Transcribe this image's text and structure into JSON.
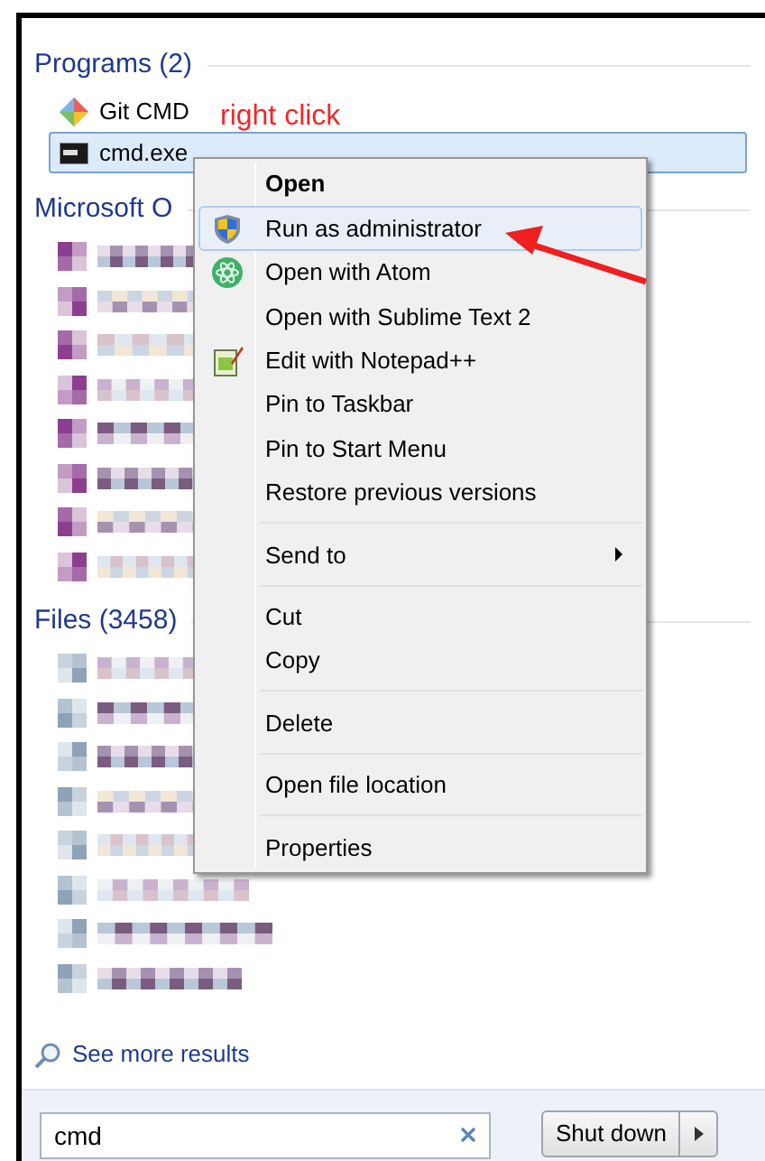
{
  "programs": {
    "header": "Programs (2)",
    "items": [
      {
        "kind": "git",
        "label": "Git CMD",
        "selected": false
      },
      {
        "kind": "console",
        "label": "cmd.exe",
        "selected": true
      }
    ]
  },
  "annotation": {
    "label": "right click"
  },
  "office": {
    "header": "Microsoft O",
    "items": [
      {
        "kind": "office"
      },
      {
        "kind": "office"
      },
      {
        "kind": "office"
      },
      {
        "kind": "office"
      },
      {
        "kind": "office"
      },
      {
        "kind": "office"
      },
      {
        "kind": "office"
      },
      {
        "kind": "office"
      }
    ]
  },
  "files": {
    "header": "Files (3458)",
    "items": [
      {
        "kind": "file"
      },
      {
        "kind": "file"
      },
      {
        "kind": "file"
      },
      {
        "kind": "file"
      },
      {
        "kind": "file"
      },
      {
        "kind": "file"
      },
      {
        "kind": "file"
      },
      {
        "kind": "file"
      }
    ]
  },
  "context_menu": [
    {
      "kind": "default",
      "label": "Open",
      "selected": false
    },
    {
      "kind": "admin",
      "label": "Run as administrator",
      "selected": true
    },
    {
      "kind": "atom",
      "label": "Open with Atom",
      "selected": false
    },
    {
      "kind": "item",
      "label": "Open with Sublime Text 2",
      "selected": false
    },
    {
      "kind": "notepad",
      "label": "Edit with Notepad++",
      "selected": false
    },
    {
      "kind": "item",
      "label": "Pin to Taskbar",
      "selected": false
    },
    {
      "kind": "item",
      "label": "Pin to Start Menu",
      "selected": false
    },
    {
      "kind": "item",
      "label": "Restore previous versions",
      "selected": false
    },
    {
      "kind": "separator"
    },
    {
      "kind": "submenu",
      "label": "Send to",
      "selected": false
    },
    {
      "kind": "separator"
    },
    {
      "kind": "item",
      "label": "Cut",
      "selected": false
    },
    {
      "kind": "item",
      "label": "Copy",
      "selected": false
    },
    {
      "kind": "separator"
    },
    {
      "kind": "item",
      "label": "Delete",
      "selected": false
    },
    {
      "kind": "separator"
    },
    {
      "kind": "item",
      "label": "Open file location",
      "selected": false
    },
    {
      "kind": "separator"
    },
    {
      "kind": "item",
      "label": "Properties",
      "selected": false
    }
  ],
  "see_more": "See more results",
  "search": {
    "value": "cmd"
  },
  "shutdown": {
    "label": "Shut down"
  }
}
